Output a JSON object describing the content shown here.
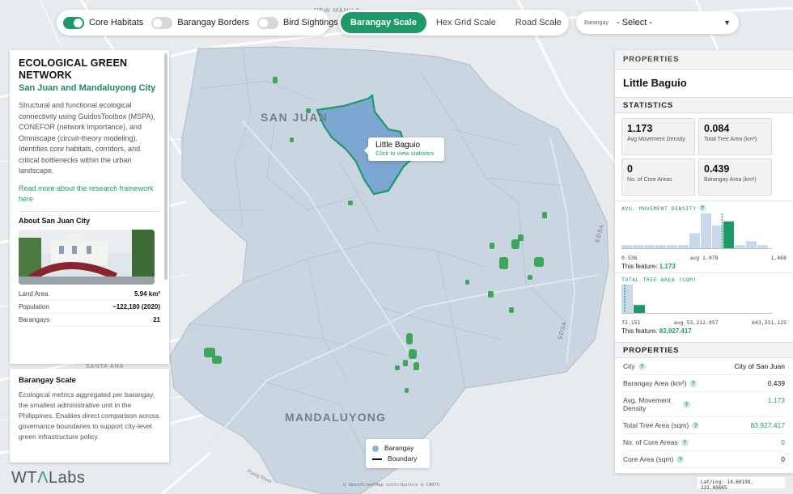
{
  "toggles": [
    {
      "label": "Core Habitats",
      "on": true
    },
    {
      "label": "Barangay Borders",
      "on": false
    },
    {
      "label": "Bird Sightings",
      "on": false
    }
  ],
  "scales": [
    {
      "label": "Barangay Scale",
      "active": true
    },
    {
      "label": "Hex Grid Scale",
      "active": false
    },
    {
      "label": "Road Scale",
      "active": false
    }
  ],
  "select": {
    "label": "Barangay",
    "value": "- Select -"
  },
  "left_panel": {
    "title": "ECOLOGICAL GREEN NETWORK",
    "subtitle": "San Juan and Mandaluyong City",
    "description": "Structural and functional ecological connectivity using GuidosToolbox (MSPA), CONEFOR (network importance), and Omniscape (circuit-theory modeling). Identifies core habitats, corridors, and critical bottlenecks within the urban landscape.",
    "link": "Read more about the research framework here",
    "about_title": "About San Juan City",
    "rows": [
      {
        "label": "Land Area",
        "value": "5.94 km²"
      },
      {
        "label": "Population",
        "value": "~122,180 (2020)"
      },
      {
        "label": "Barangays",
        "value": "21"
      }
    ]
  },
  "scale_panel": {
    "title": "Barangay Scale",
    "text": "Ecological metrics aggregated per barangay, the smallest administrative unit in the Philippines. Enables direct comparison across governance boundaries to support city-level green infrastructure policy."
  },
  "map": {
    "labels": {
      "san_juan": "SAN JUAN",
      "mandaluyong": "MANDALUYONG",
      "new_manila": "NEW MANILA",
      "edsa": "EDSA",
      "edsa2": "EDSA",
      "santa_ana": "SANTA ANA",
      "pasig_river": "Pasig River"
    },
    "tooltip": {
      "title": "Little Baguio",
      "sub": "Click to view statistics"
    },
    "legend": {
      "barangay": "Barangay",
      "boundary": "Boundary"
    },
    "attribution": "© OpenStreetMap contributors © CARTO",
    "coords": "Lat/Lng: 14.60198, 121.03665",
    "colors": {
      "barangay_fill": "#c8d6e2",
      "selected_fill": "#6f9fd0",
      "selected_stroke": "#1e9a6a",
      "habitat": "#3ea65a"
    }
  },
  "logo": {
    "a": "WT",
    "b": "Λ",
    "c": "Labs"
  },
  "right_panel": {
    "header": "PROPERTIES",
    "name": "Little Baguio",
    "stats_header": "STATISTICS",
    "stats": [
      {
        "value": "1.173",
        "label": "Avg Movement Density"
      },
      {
        "value": "0.084",
        "label": "Total Tree Area (km²)"
      },
      {
        "value": "0",
        "label": "No. of Core Areas"
      },
      {
        "value": "0.439",
        "label": "Barangay Area (km²)"
      }
    ],
    "hist1": {
      "title": "AVG. MOVEMENT DENSITY",
      "min": "0.536",
      "avg": "avg 1.078",
      "max": "1.468",
      "feature_label": "This feature:",
      "feature_value": "1.173"
    },
    "hist2": {
      "title": "TOTAL TREE AREA (SQM)",
      "min": "72.151",
      "avg": "avg 53,212.057",
      "max": "643,331.125",
      "feature_label": "This feature:",
      "feature_value": "83,927.417"
    },
    "props_header": "PROPERTIES",
    "props": [
      {
        "label": "City",
        "value": "City of San Juan",
        "green": false
      },
      {
        "label": "Barangay Area (km²)",
        "value": "0.439",
        "green": false
      },
      {
        "label": "Avg. Movement Density",
        "value": "1.173",
        "green": true
      },
      {
        "label": "Total Tree Area (sqm)",
        "value": "83,927.417",
        "green": true
      },
      {
        "label": "No. of Core Areas",
        "value": "0",
        "green": true
      },
      {
        "label": "Core Area (sqm)",
        "value": "0",
        "green": false
      }
    ]
  },
  "chart_data": [
    {
      "type": "bar",
      "title": "AVG. MOVEMENT DENSITY",
      "x_range": [
        0.536,
        1.468
      ],
      "mean": 1.078,
      "values": [
        1,
        1,
        1,
        1,
        1,
        1,
        4,
        9,
        6,
        7,
        1,
        2,
        1
      ],
      "highlight_bin": 9,
      "feature_value": 1.173
    },
    {
      "type": "bar",
      "title": "TOTAL TREE AREA (SQM)",
      "x_range": [
        72.151,
        643331.125
      ],
      "mean": 53212.057,
      "values": [
        10,
        3
      ],
      "highlight_bin": 1,
      "feature_value": 83927.417
    }
  ]
}
